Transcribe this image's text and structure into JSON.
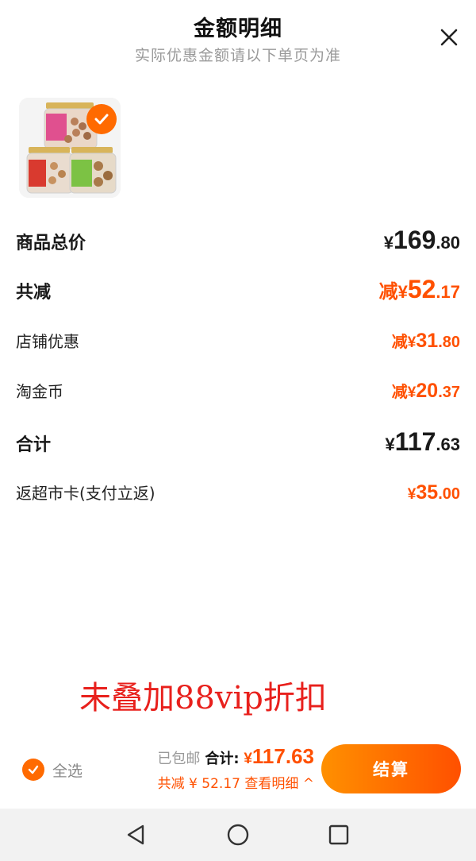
{
  "header": {
    "title": "金额明细",
    "subtitle": "实际优惠金额请以下单页为准",
    "close_icon": "close-icon"
  },
  "product": {
    "selected": true,
    "check_icon": "check-icon"
  },
  "rows": {
    "total_price": {
      "label": "商品总价",
      "symbol": "¥",
      "int": "169",
      "dec": ".80"
    },
    "total_discount": {
      "label": "共减",
      "prefix": "减",
      "symbol": "¥",
      "int": "52",
      "dec": ".17"
    },
    "shop_discount": {
      "label": "店铺优惠",
      "prefix": "减",
      "symbol": "¥",
      "int": "31",
      "dec": ".80"
    },
    "taojinbi": {
      "label": "淘金币",
      "prefix": "减",
      "symbol": "¥",
      "int": "20",
      "dec": ".37"
    },
    "subtotal": {
      "label": "合计",
      "symbol": "¥",
      "int": "117",
      "dec": ".63"
    },
    "supermarket_card": {
      "label": "返超市卡(支付立返)",
      "symbol": "¥",
      "int": "35",
      "dec": ".00"
    }
  },
  "annotation": "未叠加88vip折扣",
  "bottom_bar": {
    "select_all_label": "全选",
    "free_shipping": "已包邮",
    "total_label": "合计:",
    "total_symbol": "¥",
    "total_value": "117.63",
    "discount_line": "共减 ¥ 52.17  查看明细 ^",
    "checkout_label": "结算"
  },
  "nav": {
    "back_icon": "back-triangle-icon",
    "home_icon": "home-circle-icon",
    "recents_icon": "recents-square-icon"
  },
  "colors": {
    "accent": "#ff5000",
    "accent_light": "#ff9000",
    "annotation": "#e8201c",
    "muted": "#999999"
  }
}
